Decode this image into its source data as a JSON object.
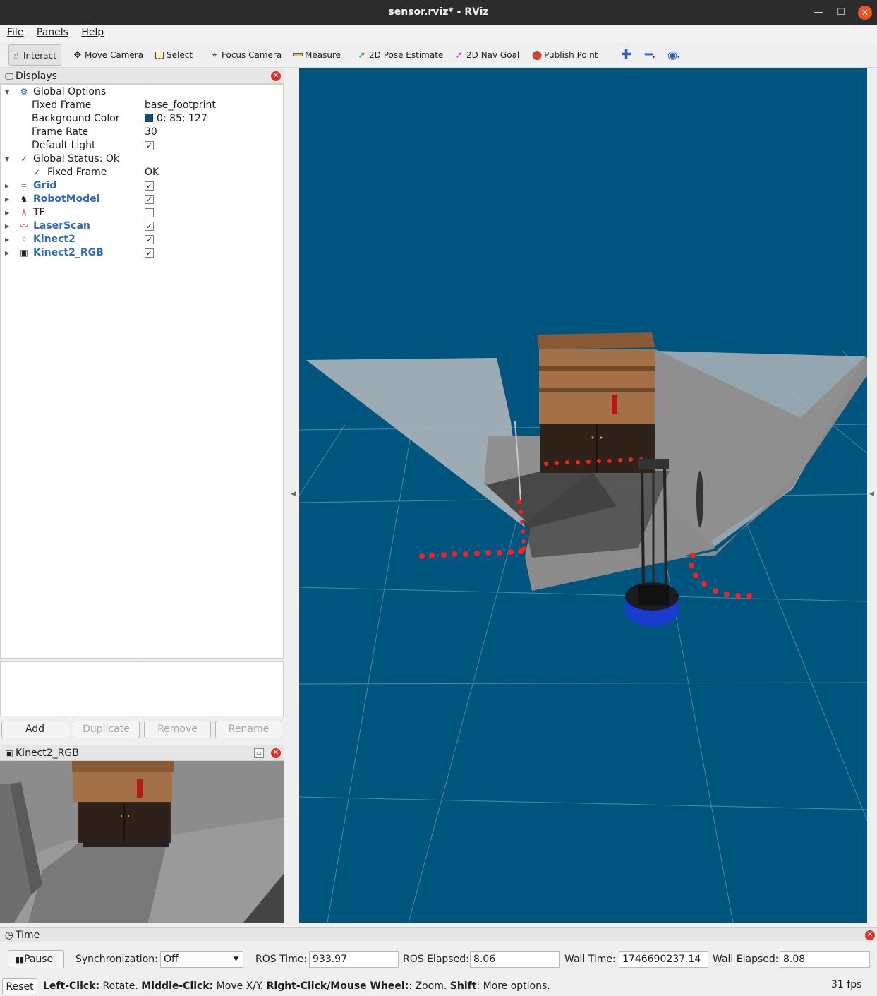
{
  "window": {
    "title": "sensor.rviz* - RViz"
  },
  "menu": {
    "file": "File",
    "panels": "Panels",
    "help": "Help"
  },
  "toolbar": {
    "interact": "Interact",
    "move_camera": "Move Camera",
    "select": "Select",
    "focus_camera": "Focus Camera",
    "measure": "Measure",
    "pose_estimate": "2D Pose Estimate",
    "nav_goal": "2D Nav Goal",
    "publish_point": "Publish Point"
  },
  "displays": {
    "title": "Displays",
    "global_options": "Global Options",
    "fixed_frame_label": "Fixed Frame",
    "fixed_frame_value": "base_footprint",
    "background_color_label": "Background Color",
    "background_color_value": "0; 85; 127",
    "background_color_hex": "#00557f",
    "frame_rate_label": "Frame Rate",
    "frame_rate_value": "30",
    "default_light_label": "Default Light",
    "global_status": "Global Status: Ok",
    "status_fixed_frame_label": "Fixed Frame",
    "status_fixed_frame_value": "OK",
    "items": [
      {
        "label": "Grid",
        "checked": true
      },
      {
        "label": "RobotModel",
        "checked": true
      },
      {
        "label": "TF",
        "checked": false
      },
      {
        "label": "LaserScan",
        "checked": true
      },
      {
        "label": "Kinect2",
        "checked": true
      },
      {
        "label": "Kinect2_RGB",
        "checked": true
      }
    ],
    "buttons": {
      "add": "Add",
      "duplicate": "Duplicate",
      "remove": "Remove",
      "rename": "Rename"
    }
  },
  "camera_panel": {
    "title": "Kinect2_RGB"
  },
  "time": {
    "title": "Time",
    "pause": "Pause",
    "sync_label": "Synchronization:",
    "sync_value": "Off",
    "ros_time_label": "ROS Time:",
    "ros_time_value": "933.97",
    "ros_elapsed_label": "ROS Elapsed:",
    "ros_elapsed_value": "8.06",
    "wall_time_label": "Wall Time:",
    "wall_time_value": "1746690237.14",
    "wall_elapsed_label": "Wall Elapsed:",
    "wall_elapsed_value": "8.08"
  },
  "status": {
    "reset": "Reset",
    "left_click": "Left-Click:",
    "left_click_desc": "Rotate.",
    "middle_click": "Middle-Click:",
    "middle_click_desc": "Move X/Y.",
    "right_click": "Right-Click/Mouse Wheel:",
    "right_click_desc": ": Zoom.",
    "shift": "Shift",
    "shift_desc": ": More options.",
    "fps": "31 fps"
  }
}
